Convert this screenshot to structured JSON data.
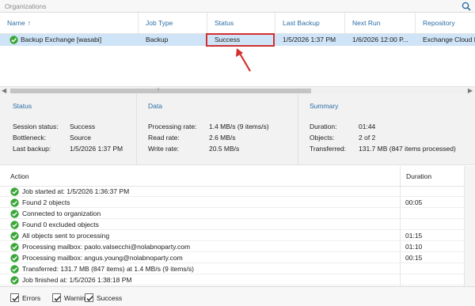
{
  "organizations": {
    "title": "Organizations",
    "search_icon": "search-icon"
  },
  "columns": [
    "Name",
    "Job Type",
    "Status",
    "Last Backup",
    "Next Run",
    "Repository"
  ],
  "sort_indicator": "↑",
  "job_row": {
    "name": "Backup Exchange [wasabi]",
    "job_type": "Backup",
    "status": "Success",
    "last_backup": "1/5/2026 1:37 PM",
    "next_run": "1/6/2026 12:00 P...",
    "repository": "Exchange Cloud R..."
  },
  "status_section": {
    "title": "Status",
    "session_status_label": "Session status:",
    "session_status_value": "Success",
    "bottleneck_label": "Bottleneck:",
    "bottleneck_value": "Source",
    "last_backup_label": "Last backup:",
    "last_backup_value": "1/5/2026 1:37 PM"
  },
  "data_section": {
    "title": "Data",
    "processing_rate_label": "Processing rate:",
    "processing_rate_value": "1.4 MB/s (9 items/s)",
    "read_rate_label": "Read rate:",
    "read_rate_value": "2.6 MB/s",
    "write_rate_label": "Write rate:",
    "write_rate_value": "20.5 MB/s"
  },
  "summary_section": {
    "title": "Summary",
    "duration_label": "Duration:",
    "duration_value": "01:44",
    "objects_label": "Objects:",
    "objects_value": "2 of 2",
    "transferred_label": "Transferred:",
    "transferred_value": "131.7 MB (847 items processed)"
  },
  "action_header": {
    "action": "Action",
    "duration": "Duration"
  },
  "log": [
    {
      "text": "Job started at: 1/5/2026 1:36:37 PM",
      "duration": ""
    },
    {
      "text": "Found 2 objects",
      "duration": "00:05"
    },
    {
      "text": "Connected to organization",
      "duration": ""
    },
    {
      "text": "Found 0 excluded objects",
      "duration": ""
    },
    {
      "text": "All objects sent to processing",
      "duration": "01:15"
    },
    {
      "text": "Processing mailbox: paolo.valsecchi@nolabnoparty.com",
      "duration": "01:10"
    },
    {
      "text": "Processing mailbox: angus.young@nolabnoparty.com",
      "duration": "00:15"
    },
    {
      "text": "Transferred: 131.7 MB (847 items) at 1.4 MB/s (9 items/s)",
      "duration": ""
    },
    {
      "text": "Job finished at: 1/5/2026 1:38:18 PM",
      "duration": ""
    }
  ],
  "filters": [
    {
      "label": "Errors",
      "checked": true
    },
    {
      "label": "Warnings",
      "checked": true
    },
    {
      "label": "Success",
      "checked": true
    }
  ],
  "colors": {
    "accent": "#2b6ea5",
    "selected_row": "#cfe4f7",
    "success": "#3aa63a",
    "highlight": "#d32f2f"
  }
}
